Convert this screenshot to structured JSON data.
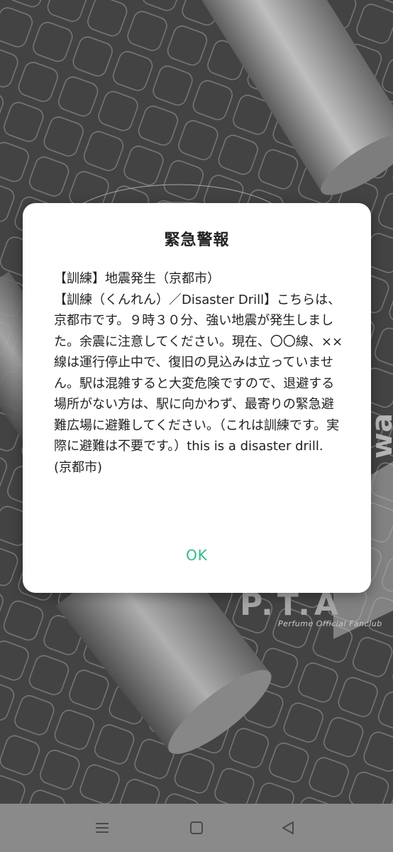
{
  "wallpaper": {
    "fanclub_text": "Perfume Official Fanclub",
    "logo_text": "P.T.A",
    "side_text": "wa"
  },
  "dialog": {
    "title": "緊急警報",
    "lines": [
      "【訓練】地震発生（京都市）",
      "【訓練（くんれん）／Disaster Drill】こちらは、京都市です。９時３０分、強い地震が発生しました。余震に注意してください。現在、〇〇線、××線は運行停止中で、復旧の見込みは立っていません。駅は混雑すると大変危険ですので、退避する場所がない方は、駅に向かわず、最寄りの緊急避難広場に避難してください。（これは訓練です。実際に避難は不要です。）this is a disaster drill.",
      "(京都市)"
    ],
    "ok_label": "OK"
  },
  "navbar": {
    "menu_icon": "menu-icon",
    "home_icon": "home-icon",
    "back_icon": "back-icon"
  },
  "colors": {
    "accent": "#2bbf84",
    "background": "#4d4d4d",
    "navbar": "#8a8a8a"
  }
}
